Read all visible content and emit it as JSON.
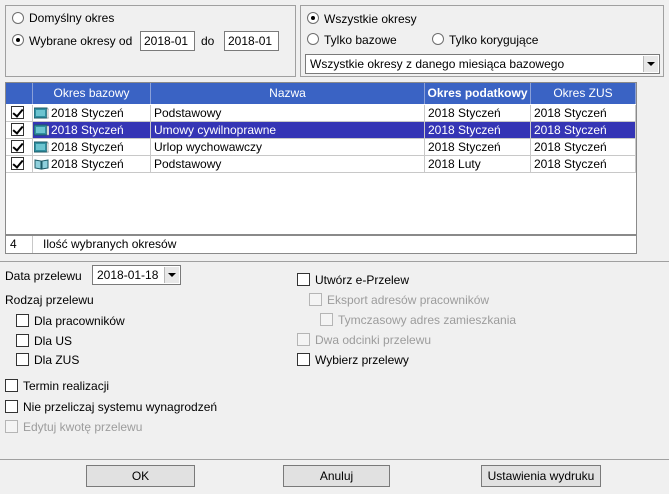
{
  "period_mode": {
    "default_label": "Domyślny  okres",
    "selected_label": "Wybrane okresy od",
    "from_value": "2018-01",
    "to_label": "do",
    "to_value": "2018-01"
  },
  "period_type": {
    "all_label": "Wszystkie okresy",
    "base_label": "Tylko bazowe",
    "corrective_label": "Tylko korygujące",
    "filter_value": "Wszystkie okresy z danego miesiąca bazowego"
  },
  "grid": {
    "columns": [
      "Okres bazowy",
      "Nazwa",
      "Okres podatkowy",
      "Okres ZUS"
    ],
    "rows": [
      {
        "base": "2018 Styczeń",
        "name": "Podstawowy",
        "tax": "2018 Styczeń",
        "zus": "2018 Styczeń",
        "checked": true,
        "selected": false,
        "icon": "book-closed-icon"
      },
      {
        "base": "2018 Styczeń",
        "name": "Umowy cywilnoprawne",
        "tax": "2018 Styczeń",
        "zus": "2018 Styczeń",
        "checked": true,
        "selected": true,
        "icon": "book-closed-icon"
      },
      {
        "base": "2018 Styczeń",
        "name": "Urlop wychowawczy",
        "tax": "2018 Styczeń",
        "zus": "2018 Styczeń",
        "checked": true,
        "selected": false,
        "icon": "book-closed-icon"
      },
      {
        "base": "2018 Styczeń",
        "name": "Podstawowy",
        "tax": "2018 Luty",
        "zus": "2018 Styczeń",
        "checked": true,
        "selected": false,
        "icon": "book-open-icon"
      }
    ],
    "summary_count": "4",
    "summary_label": "Ilość wybranych okresów"
  },
  "transfer": {
    "date_label": "Data przelewu",
    "date_value": "2018-01-18",
    "type_label": "Rodzaj przelewu",
    "for_employees": "Dla pracowników",
    "for_us": "Dla US",
    "for_zus": "Dla ZUS",
    "due_date": "Termin realizacji",
    "no_recalc": "Nie przeliczaj systemu wynagrodzeń",
    "edit_amount": "Edytuj kwotę przelewu"
  },
  "eprzelew": {
    "create_label": "Utwórz e-Przelew",
    "export_addresses": "Eksport adresów pracowników",
    "temp_address": "Tymczasowy adres zamieszkania",
    "two_stubs": "Dwa odcinki przelewu",
    "choose_transfers": "Wybierz przelewy"
  },
  "buttons": {
    "ok": "OK",
    "cancel": "Anuluj",
    "print_settings": "Ustawienia wydruku"
  },
  "colors": {
    "header_bg": "#3a63c4",
    "selection_bg": "#3535b5",
    "window_bg": "#f0f0f0"
  }
}
